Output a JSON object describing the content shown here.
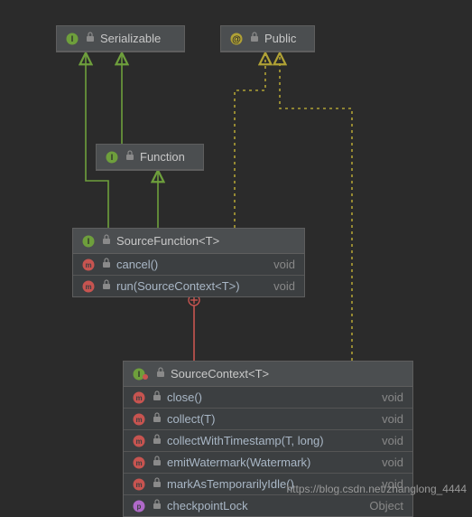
{
  "boxes": {
    "serializable": {
      "title": "Serializable"
    },
    "public": {
      "title": "Public"
    },
    "function": {
      "title": "Function"
    },
    "sourceFunction": {
      "title": "SourceFunction<T>",
      "members": [
        {
          "name": "cancel()",
          "type": "void"
        },
        {
          "name": "run(SourceContext<T>)",
          "type": "void"
        }
      ]
    },
    "sourceContext": {
      "title": "SourceContext<T>",
      "members": [
        {
          "name": "close()",
          "type": "void"
        },
        {
          "name": "collect(T)",
          "type": "void"
        },
        {
          "name": "collectWithTimestamp(T, long)",
          "type": "void"
        },
        {
          "name": "emitWatermark(Watermark)",
          "type": "void"
        },
        {
          "name": "markAsTemporarilyIdle()",
          "type": "void"
        },
        {
          "name": "checkpointLock",
          "type": "Object"
        }
      ]
    }
  },
  "watermark": "https://blog.csdn.net/zhanglong_4444",
  "colors": {
    "interface_icon": "#6e9f3c",
    "annotation_icon": "#b0a135",
    "method_icon": "#c75450",
    "property_icon": "#b069c9",
    "inherit_line": "#6e9f3c",
    "annotation_line": "#b0a135",
    "inner_line": "#c75450"
  }
}
